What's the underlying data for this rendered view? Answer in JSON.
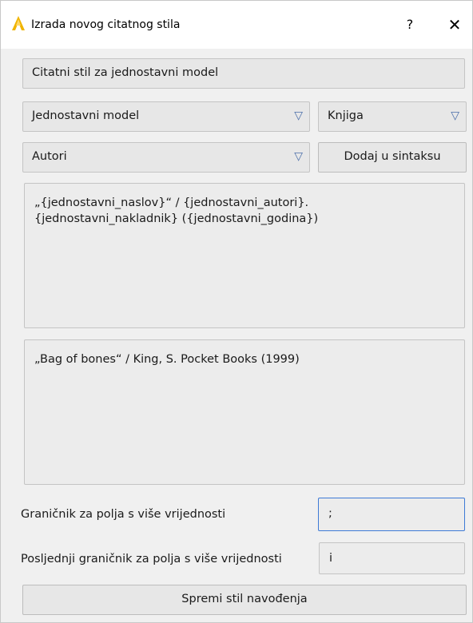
{
  "window": {
    "title": "Izrada novog citatnog stila",
    "help_label": "?",
    "close_label": "✕",
    "icon": "app-logo-icon"
  },
  "style_name": {
    "value": "Citatni stil za jednostavni model"
  },
  "model_select": {
    "selected": "Jednostavni model",
    "arrow": "▽"
  },
  "type_select": {
    "selected": "Knjiga",
    "arrow": "▽"
  },
  "field_select": {
    "selected": "Autori",
    "arrow": "▽"
  },
  "add_button": {
    "label": "Dodaj u sintaksu"
  },
  "syntax": {
    "line1": "„{jednostavni_naslov}“ / {jednostavni_autori}.",
    "line2": "{jednostavni_nakladnik} ({jednostavni_godina})"
  },
  "preview": {
    "text": "„Bag of bones“ / King, S. Pocket Books (1999)"
  },
  "separator": {
    "label": "Graničnik za polja s više vrijednosti",
    "value": ";"
  },
  "last_separator": {
    "label": "Posljednji graničnik za polja s više vrijednosti",
    "value": "i"
  },
  "save_button": {
    "label": "Spremi stil navođenja"
  },
  "colors": {
    "accent": "#3d7ad6",
    "arrow": "#4a6ea9",
    "logo": "#f0b400"
  }
}
